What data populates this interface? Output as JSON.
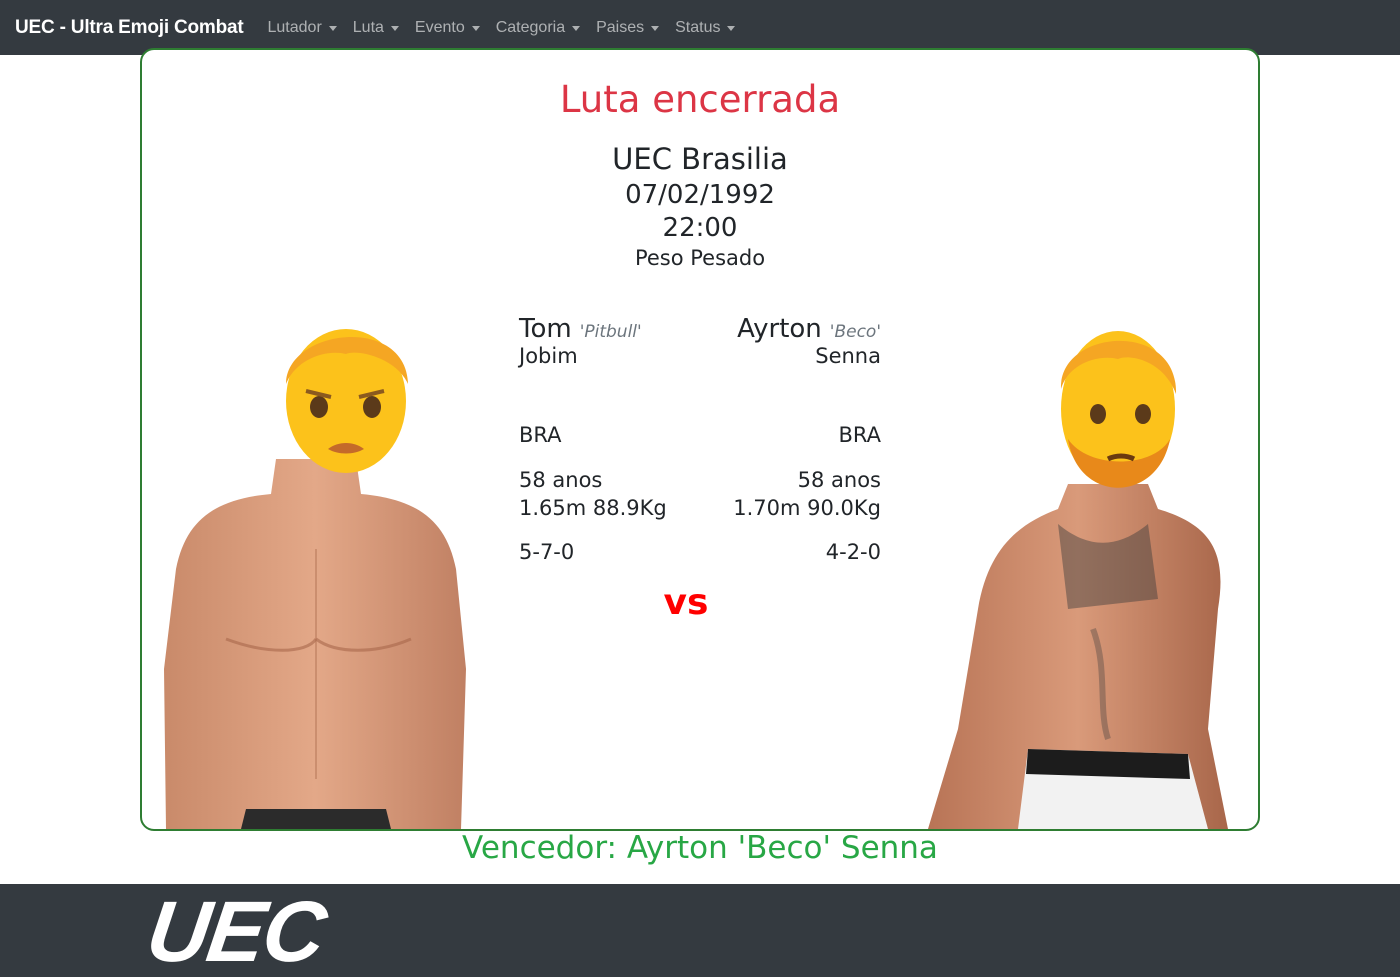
{
  "navbar": {
    "brand": "UEC - Ultra Emoji Combat",
    "items": [
      {
        "label": "Lutador"
      },
      {
        "label": "Luta"
      },
      {
        "label": "Evento"
      },
      {
        "label": "Categoria"
      },
      {
        "label": "Paises"
      },
      {
        "label": "Status"
      }
    ]
  },
  "fight": {
    "status": "Luta encerrada",
    "event": "UEC Brasilia",
    "date": "07/02/1992",
    "time": "22:00",
    "category": "Peso Pesado",
    "vs_label": "vs",
    "winner": "Vencedor: Ayrton 'Beco' Senna"
  },
  "fighter_left": {
    "first_name": "Tom",
    "nickname": "'Pitbull'",
    "last_name": "Jobim",
    "country": "BRA",
    "age": "58 anos",
    "measures": "1.65m 88.9Kg",
    "record": "5-7-0",
    "emoji": "man-face-emoji"
  },
  "fighter_right": {
    "first_name": "Ayrton",
    "nickname": "'Beco'",
    "last_name": "Senna",
    "country": "BRA",
    "age": "58 anos",
    "measures": "1.70m 90.0Kg",
    "record": "4-2-0",
    "emoji": "bearded-man-face-emoji"
  },
  "footer": {
    "logo_text": "UEC"
  },
  "colors": {
    "navbar": "#343a40",
    "status": "#dc3545",
    "winner": "#28a745",
    "vs": "#ff0000",
    "card_border": "#2e7d32",
    "skin": "#e8a781",
    "emoji_yellow": "#fcc21b"
  }
}
